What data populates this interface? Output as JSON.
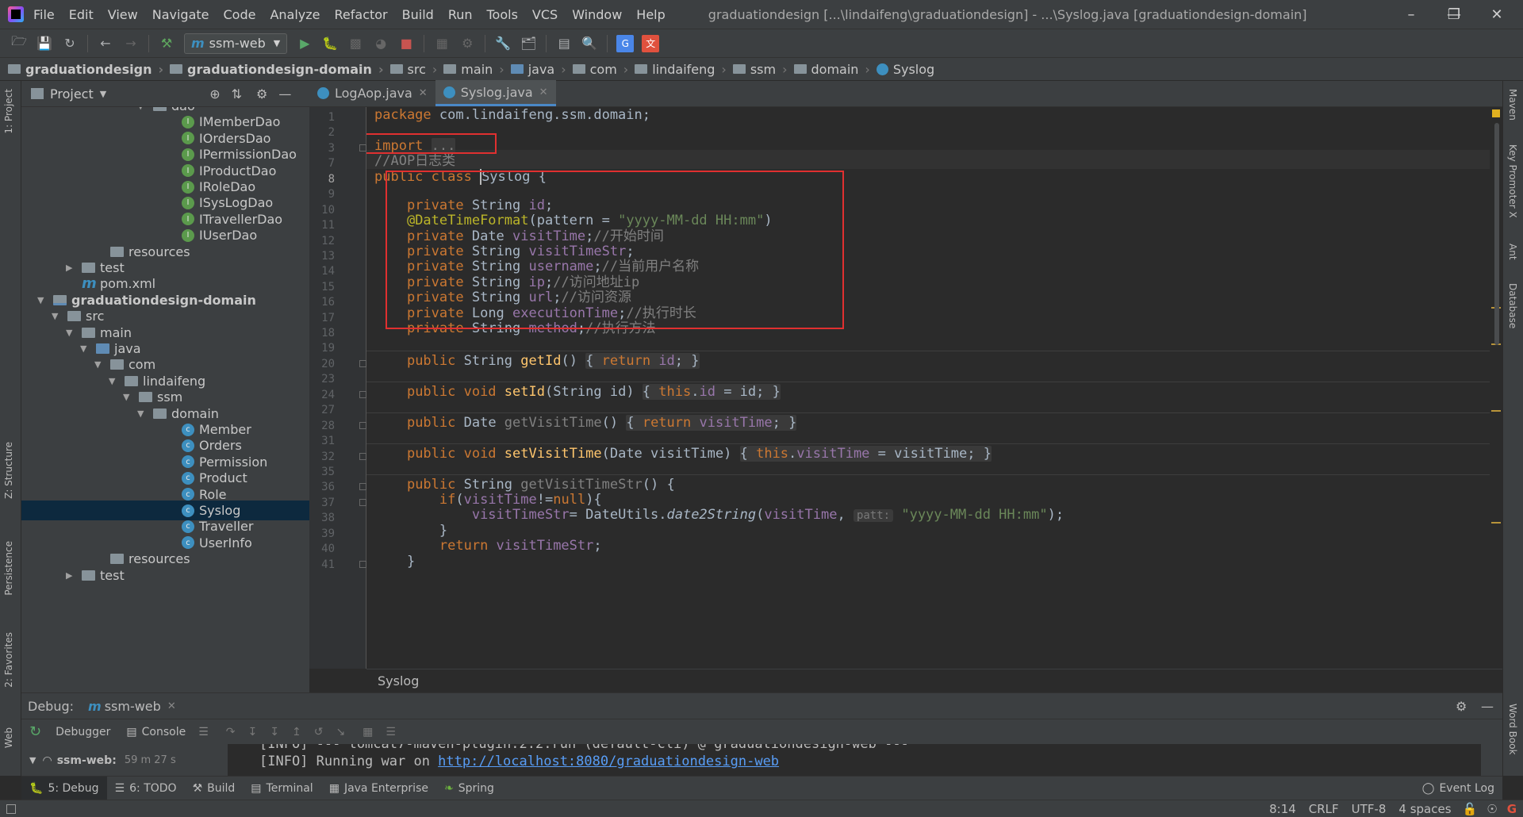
{
  "menu": [
    "File",
    "Edit",
    "View",
    "Navigate",
    "Code",
    "Analyze",
    "Refactor",
    "Build",
    "Run",
    "Tools",
    "VCS",
    "Window",
    "Help"
  ],
  "window_title": "graduationdesign [...\\lindaifeng\\graduationdesign] - ...\\Syslog.java [graduationdesign-domain]",
  "toolbar": {
    "run_config": "ssm-web"
  },
  "breadcrumb": [
    "graduationdesign",
    "graduationdesign-domain",
    "src",
    "main",
    "java",
    "com",
    "lindaifeng",
    "ssm",
    "domain",
    "Syslog"
  ],
  "project_panel": {
    "title": "Project"
  },
  "tree": [
    {
      "label": "dao",
      "indent": 8,
      "icon": "folder",
      "arrow": "down"
    },
    {
      "label": "IMemberDao",
      "indent": 10,
      "icon": "interface"
    },
    {
      "label": "IOrdersDao",
      "indent": 10,
      "icon": "interface"
    },
    {
      "label": "IPermissionDao",
      "indent": 10,
      "icon": "interface"
    },
    {
      "label": "IProductDao",
      "indent": 10,
      "icon": "interface"
    },
    {
      "label": "IRoleDao",
      "indent": 10,
      "icon": "interface"
    },
    {
      "label": "ISysLogDao",
      "indent": 10,
      "icon": "interface"
    },
    {
      "label": "ITravellerDao",
      "indent": 10,
      "icon": "interface"
    },
    {
      "label": "IUserDao",
      "indent": 10,
      "icon": "interface"
    },
    {
      "label": "resources",
      "indent": 5,
      "icon": "folder"
    },
    {
      "label": "test",
      "indent": 3,
      "icon": "folder",
      "arrow": "right"
    },
    {
      "label": "pom.xml",
      "indent": 3,
      "icon": "maven"
    },
    {
      "label": "graduationdesign-domain",
      "indent": 1,
      "icon": "module",
      "arrow": "down",
      "bold": true
    },
    {
      "label": "src",
      "indent": 2,
      "icon": "folder",
      "arrow": "down"
    },
    {
      "label": "main",
      "indent": 3,
      "icon": "folder",
      "arrow": "down"
    },
    {
      "label": "java",
      "indent": 4,
      "icon": "src",
      "arrow": "down"
    },
    {
      "label": "com",
      "indent": 5,
      "icon": "folder",
      "arrow": "down"
    },
    {
      "label": "lindaifeng",
      "indent": 6,
      "icon": "folder",
      "arrow": "down"
    },
    {
      "label": "ssm",
      "indent": 7,
      "icon": "folder",
      "arrow": "down"
    },
    {
      "label": "domain",
      "indent": 8,
      "icon": "folder",
      "arrow": "down"
    },
    {
      "label": "Member",
      "indent": 10,
      "icon": "class"
    },
    {
      "label": "Orders",
      "indent": 10,
      "icon": "class"
    },
    {
      "label": "Permission",
      "indent": 10,
      "icon": "class"
    },
    {
      "label": "Product",
      "indent": 10,
      "icon": "class"
    },
    {
      "label": "Role",
      "indent": 10,
      "icon": "class"
    },
    {
      "label": "Syslog",
      "indent": 10,
      "icon": "class",
      "selected": true
    },
    {
      "label": "Traveller",
      "indent": 10,
      "icon": "class"
    },
    {
      "label": "UserInfo",
      "indent": 10,
      "icon": "class"
    },
    {
      "label": "resources",
      "indent": 5,
      "icon": "folder"
    },
    {
      "label": "test",
      "indent": 3,
      "icon": "folder",
      "arrow": "right"
    }
  ],
  "tabs": [
    {
      "label": "LogAop.java",
      "active": false
    },
    {
      "label": "Syslog.java",
      "active": true
    }
  ],
  "line_numbers": [
    "1",
    "2",
    "3",
    "7",
    "8",
    "9",
    "10",
    "11",
    "12",
    "13",
    "14",
    "15",
    "16",
    "17",
    "18",
    "19",
    "20",
    "23",
    "24",
    "27",
    "28",
    "31",
    "32",
    "35",
    "36",
    "37",
    "38",
    "39",
    "40",
    "41"
  ],
  "code": {
    "l1": {
      "kw": "package ",
      "rest": "com.lindaifeng.ssm.domain;"
    },
    "l3": {
      "kw": "import ",
      "folded": "..."
    },
    "l7": {
      "comment": "//AOP日志类"
    },
    "l8": {
      "kw": "public class ",
      "name": "Syslog",
      " rest": " {"
    },
    "fields": [
      {
        "mod": "private ",
        "type": "String ",
        "name": "id",
        "rest": ";",
        "comment": ""
      },
      {
        "annotation": "@DateTimeFormat",
        "arg": "pattern = ",
        "str": "\"yyyy-MM-dd HH:mm\""
      },
      {
        "mod": "private ",
        "type": "Date ",
        "name": "visitTime",
        "rest": ";",
        "comment": "//开始时间"
      },
      {
        "mod": "private ",
        "type": "String ",
        "name": "visitTimeStr",
        "rest": ";",
        "comment": ""
      },
      {
        "mod": "private ",
        "type": "String ",
        "name": "username",
        "rest": ";",
        "comment": "//当前用户名称"
      },
      {
        "mod": "private ",
        "type": "String ",
        "name": "ip",
        "rest": ";",
        "comment": "//访问地址ip"
      },
      {
        "mod": "private ",
        "type": "String ",
        "name": "url",
        "rest": ";",
        "comment": "//访问资源"
      },
      {
        "mod": "private ",
        "type": "Long ",
        "name": "executionTime",
        "rest": ";",
        "comment": "//执行时长"
      },
      {
        "mod": "private ",
        "type": "String ",
        "name": "method",
        "rest": ";",
        "comment": "//执行方法"
      }
    ],
    "m_getId": {
      "sig": "public String ",
      "fn": "getId",
      "tail": "() ",
      "body_kw": "return ",
      "body_field": "id"
    },
    "m_setId": {
      "sig": "public void ",
      "fn": "setId",
      "tail": "(String id) ",
      "kw_this": "this",
      "field": ".id",
      " rest": " = id;"
    },
    "m_getVisitTime": {
      "sig": "public Date ",
      "fn": "getVisitTime",
      "tail": "() ",
      "body_kw": "return ",
      "body_field": "visitTime"
    },
    "m_setVisitTime": {
      "sig": "public void ",
      "fn": "setVisitTime",
      "tail": "(Date visitTime) ",
      "kw_this": "this",
      "field": ".visitTime",
      "rest": " = visitTime;"
    },
    "m_getVisitTimeStr": {
      "sig": "public String ",
      "fn": "getVisitTimeStr",
      "tail": "() {"
    },
    "l37": {
      "kw": "if",
      "rest1": "(",
      "field": "visitTime",
      "rest2": "!=",
      "kw2": "null",
      "rest3": "){"
    },
    "l38": {
      "field": "visitTimeStr",
      "rest1": "= DateUtils.",
      "method": "date2String",
      "rest2": "(",
      "field2": "visitTime",
      ",": ",",
      "hint": "patt:",
      "str": "\"yyyy-MM-dd HH:mm\"",
      "rest3": ");"
    },
    "l39": {
      "text": "}"
    },
    "l40": {
      "kw": "return ",
      "field": "visitTimeStr",
      "rest": ";"
    },
    "l41": {
      "text": "}"
    }
  },
  "editor_footer": "Syslog",
  "debug": {
    "label": "Debug:",
    "config": "ssm-web",
    "tabs": [
      "Debugger",
      "Console"
    ],
    "frame": "ssm-web:",
    "frame_time": "59 m 27 s",
    "console_line1": "[INFO] --- tomcat7-maven-plugin:2.2:run (default-cli) @ graduationdesign-web ---",
    "console_line2_prefix": "[INFO] Running war on ",
    "console_link": "http://localhost:8080/graduationdesign-web"
  },
  "bottom_tools": [
    {
      "label": "5: Debug",
      "active": true
    },
    {
      "label": "6: TODO"
    },
    {
      "label": "Build"
    },
    {
      "label": "Terminal"
    },
    {
      "label": "Java Enterprise"
    },
    {
      "label": "Spring"
    }
  ],
  "event_log": "Event Log",
  "status": {
    "position": "8:14",
    "line_sep": "CRLF",
    "encoding": "UTF-8",
    "indent": "4 spaces"
  },
  "left_tabs": [
    "1: Project",
    "Z: Structure",
    "Persistence",
    "2: Favorites",
    "Web"
  ],
  "right_tabs": [
    "Maven",
    "Key Promoter X",
    "Ant",
    "Database",
    "Word Book"
  ]
}
